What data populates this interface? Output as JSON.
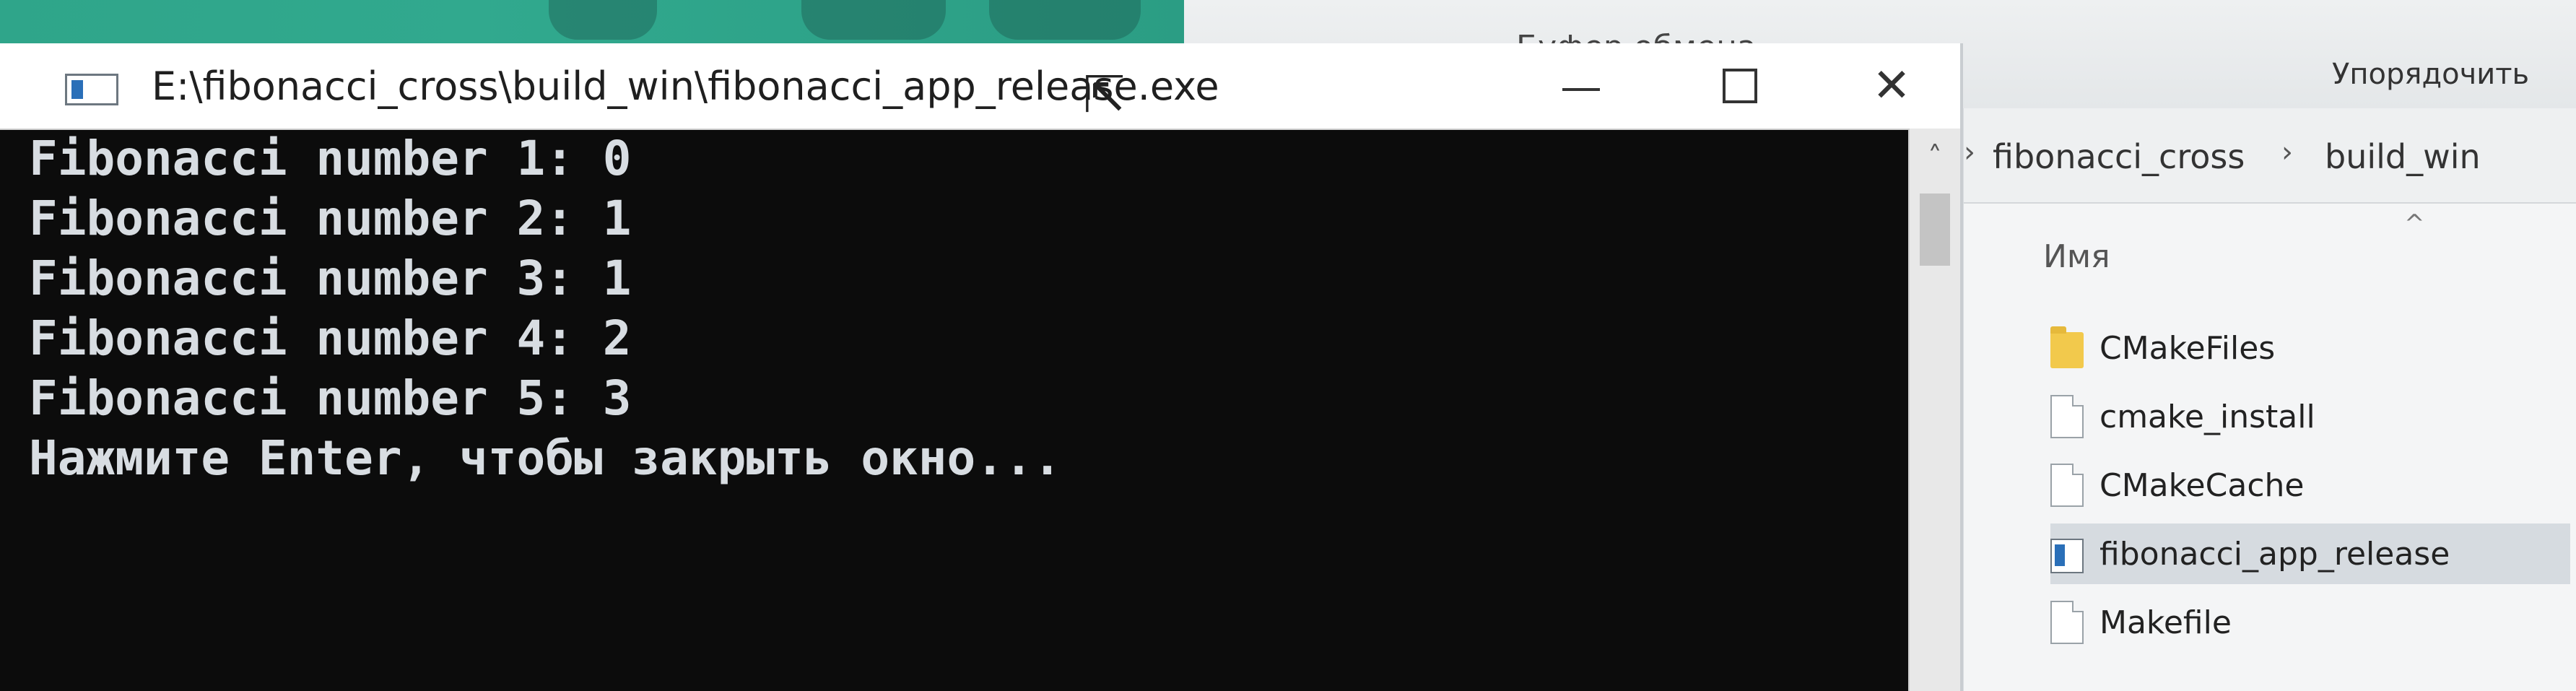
{
  "background": {
    "ribbon_group_label": "Буфер обмена",
    "ribbon_sort_label": "Упорядочить"
  },
  "console": {
    "title": "E:\\fibonacci_cross\\build_win\\fibonacci_app_release.exe",
    "lines": [
      "Fibonacci number 1: 0",
      "Fibonacci number 2: 1",
      "Fibonacci number 3: 1",
      "Fibonacci number 4: 2",
      "Fibonacci number 5: 3",
      "Нажмите Enter, чтобы закрыть окно..."
    ],
    "buttons": {
      "minimize_icon": "minimize-icon",
      "maximize_icon": "maximize-icon",
      "close_icon": "close-icon"
    },
    "colors": {
      "background": "#0c0c0c",
      "text": "#d8dde2"
    }
  },
  "explorer": {
    "breadcrumb": [
      "fibonacci_cross",
      "build_win"
    ],
    "column_header": "Имя",
    "files": [
      {
        "name": "CMakeFiles",
        "icon": "folder-icon",
        "selected": false
      },
      {
        "name": "cmake_install",
        "icon": "document-icon",
        "selected": false
      },
      {
        "name": "CMakeCache",
        "icon": "document-icon",
        "selected": false
      },
      {
        "name": "fibonacci_app_release",
        "icon": "application-icon",
        "selected": true
      },
      {
        "name": "Makefile",
        "icon": "document-icon",
        "selected": false
      }
    ]
  }
}
